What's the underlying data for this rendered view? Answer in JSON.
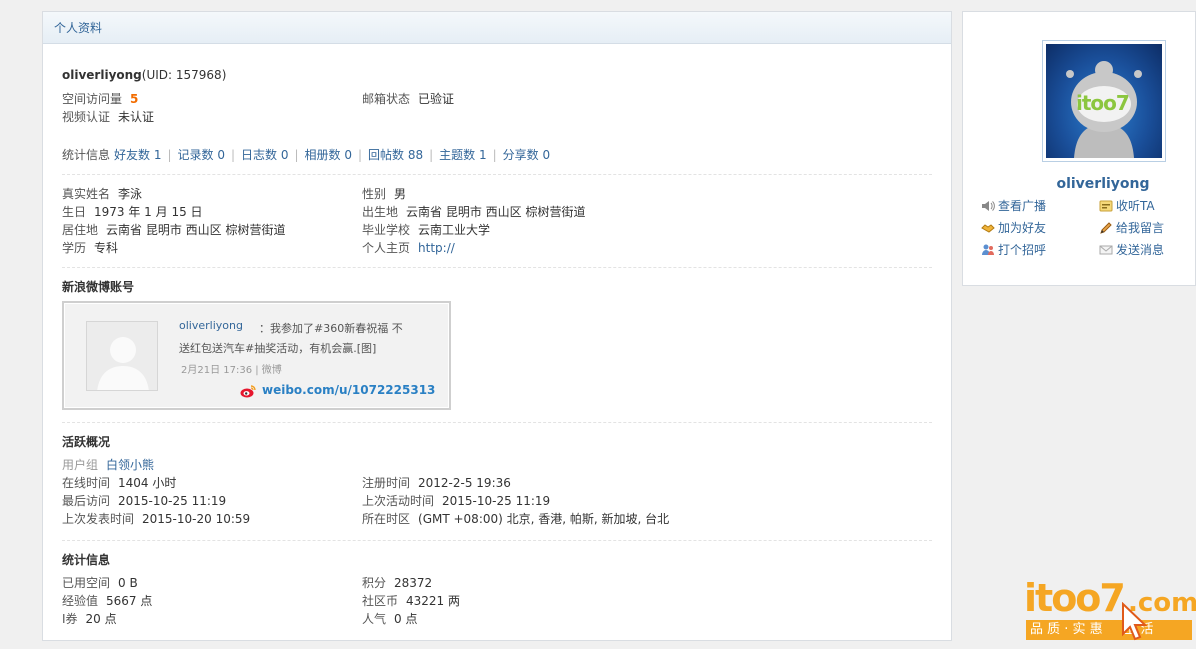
{
  "header": {
    "title": "个人资料"
  },
  "profile": {
    "username": "oliverliyong",
    "uid": "(UID: 157968)",
    "visits_label": "空间访问量",
    "visits_value": "5",
    "email_label": "邮箱状态",
    "email_value": "已验证",
    "video_label": "视频认证",
    "video_value": "未认证"
  },
  "stats_links": {
    "label": "统计信息",
    "items": [
      {
        "label": "好友数 1"
      },
      {
        "label": "记录数 0"
      },
      {
        "label": "日志数 0"
      },
      {
        "label": "相册数 0"
      },
      {
        "label": "回帖数 88"
      },
      {
        "label": "主题数 1"
      },
      {
        "label": "分享数 0"
      }
    ]
  },
  "details": {
    "realname_label": "真实姓名",
    "realname": "李泳",
    "gender_label": "性别",
    "gender": "男",
    "birthday_label": "生日",
    "birthday": "1973 年 1 月 15 日",
    "birthplace_label": "出生地",
    "birthplace": "云南省 昆明市 西山区 棕树营街道",
    "residence_label": "居住地",
    "residence": "云南省 昆明市 西山区 棕树营街道",
    "school_label": "毕业学校",
    "school": "云南工业大学",
    "education_label": "学历",
    "education": "专科",
    "homepage_label": "个人主页",
    "homepage": "http://"
  },
  "weibo": {
    "title": "新浪微博账号",
    "name": "oliverliyong",
    "text": "：我参加了#360新春祝福 不送红包送汽车#抽奖活动，有机会赢.[图]",
    "meta": "2月21日 17:36 | 微博",
    "url": "weibo.com/u/1072225313"
  },
  "activity": {
    "title": "活跃概况",
    "group_label": "用户组",
    "group": "白领小熊",
    "online_label": "在线时间",
    "online": "1404 小时",
    "register_label": "注册时间",
    "register": "2012-2-5 19:36",
    "lastvisit_label": "最后访问",
    "lastvisit": "2015-10-25 11:19",
    "lastactive_label": "上次活动时间",
    "lastactive": "2015-10-25 11:19",
    "lastpost_label": "上次发表时间",
    "lastpost": "2015-10-20 10:59",
    "timezone_label": "所在时区",
    "timezone": "(GMT +08:00) 北京, 香港, 帕斯, 新加坡, 台北"
  },
  "statistics": {
    "title": "统计信息",
    "space_label": "已用空间",
    "space": "0 B",
    "points_label": "积分",
    "points": "28372",
    "exp_label": "经验值",
    "exp": "5667 点",
    "coins_label": "社区币",
    "coins": "43221 两",
    "voucher_label": "I券",
    "voucher": "20 点",
    "popularity_label": "人气",
    "popularity": "0 点"
  },
  "sidebar": {
    "avatar_text": "itoo7",
    "username": "oliverliyong",
    "actions": [
      {
        "label": "查看广播",
        "icon": "speaker-icon"
      },
      {
        "label": "收听TA",
        "icon": "follow-icon"
      },
      {
        "label": "加为好友",
        "icon": "handshake-icon"
      },
      {
        "label": "给我留言",
        "icon": "pencil-icon"
      },
      {
        "label": "打个招呼",
        "icon": "users-icon"
      },
      {
        "label": "发送消息",
        "icon": "envelope-icon"
      }
    ]
  },
  "brand": {
    "logo_text": "itoo7",
    "domain_text": ".com",
    "slogan": "品 质 · 实 惠     生 活"
  },
  "colors": {
    "link": "#336699",
    "accent_orange": "#f26c00",
    "weibo_blue": "#2a80c4"
  }
}
